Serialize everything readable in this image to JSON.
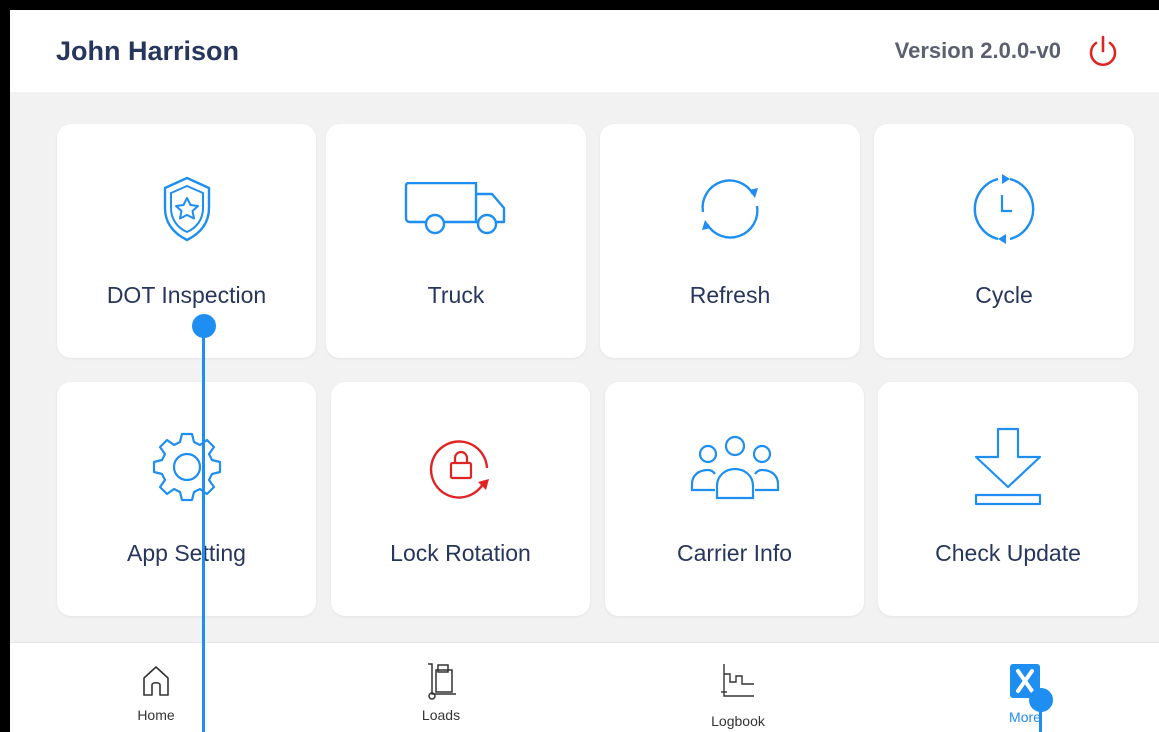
{
  "header": {
    "user_name": "John Harrison",
    "version": "Version 2.0.0-v0"
  },
  "tiles": [
    {
      "label": "DOT Inspection",
      "icon": "shield-star-icon"
    },
    {
      "label": "Truck",
      "icon": "truck-icon"
    },
    {
      "label": "Refresh",
      "icon": "refresh-icon"
    },
    {
      "label": "Cycle",
      "icon": "cycle-clock-icon"
    },
    {
      "label": "App Setting",
      "icon": "gear-icon"
    },
    {
      "label": "Lock Rotation",
      "icon": "lock-rotation-icon"
    },
    {
      "label": "Carrier Info",
      "icon": "group-icon"
    },
    {
      "label": "Check Update",
      "icon": "download-icon"
    }
  ],
  "tabs": [
    {
      "label": "Home",
      "icon": "home-icon"
    },
    {
      "label": "Loads",
      "icon": "dolly-icon"
    },
    {
      "label": "Logbook",
      "icon": "logbook-graph-icon"
    },
    {
      "label": "More",
      "icon": "more-x-icon",
      "active": true
    }
  ],
  "colors": {
    "accent": "#1e8ef0",
    "title": "#27365c",
    "danger": "#e02424",
    "background": "#f2f2f2"
  }
}
